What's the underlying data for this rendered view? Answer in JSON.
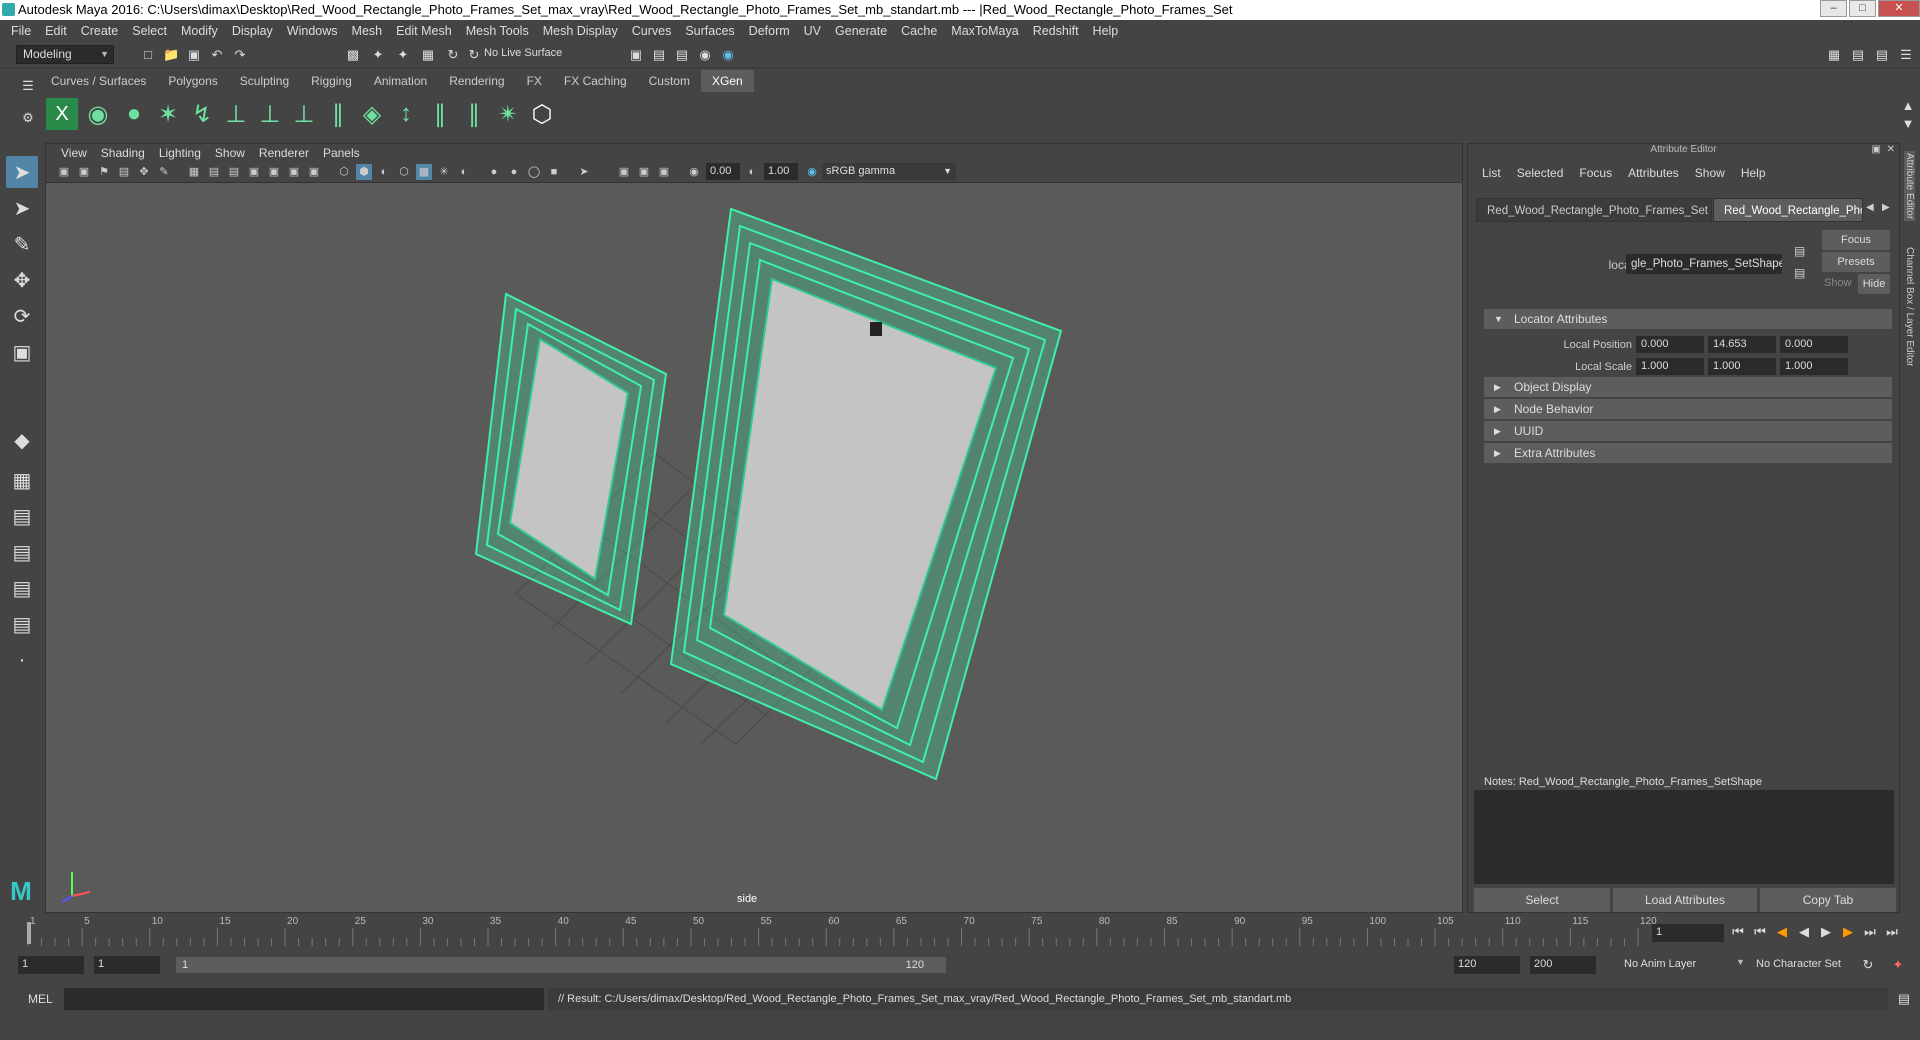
{
  "window": {
    "title": "Autodesk Maya 2016: C:\\Users\\dimax\\Desktop\\Red_Wood_Rectangle_Photo_Frames_Set_max_vray\\Red_Wood_Rectangle_Photo_Frames_Set_mb_standart.mb   ---   |Red_Wood_Rectangle_Photo_Frames_Set"
  },
  "menubar": [
    "File",
    "Edit",
    "Create",
    "Select",
    "Modify",
    "Display",
    "Windows",
    "Mesh",
    "Edit Mesh",
    "Mesh Tools",
    "Mesh Display",
    "Curves",
    "Surfaces",
    "Deform",
    "UV",
    "Generate",
    "Cache",
    "MaxToMaya",
    "Redshift",
    "Help"
  ],
  "toolbar": {
    "mode": "Modeling",
    "live_surface": "No Live Surface"
  },
  "shelf_tabs": [
    "Curves / Surfaces",
    "Polygons",
    "Sculpting",
    "Rigging",
    "Animation",
    "Rendering",
    "FX",
    "FX Caching",
    "Custom",
    "XGen"
  ],
  "shelf_active": "XGen",
  "viewport": {
    "menu": [
      "View",
      "Shading",
      "Lighting",
      "Show",
      "Renderer",
      "Panels"
    ],
    "exposure": "0.00",
    "gamma": "1.00",
    "color_space": "sRGB gamma",
    "camera_label": "side",
    "wire_color": "#3ef0a8"
  },
  "attr_editor": {
    "title": "Attribute Editor",
    "menu": [
      "List",
      "Selected",
      "Focus",
      "Attributes",
      "Show",
      "Help"
    ],
    "tabs": [
      "Red_Wood_Rectangle_Photo_Frames_Set",
      "Red_Wood_Rectangle_Pho"
    ],
    "buttons": {
      "focus": "Focus",
      "presets": "Presets",
      "show": "Show",
      "hide": "Hide"
    },
    "locator_label": "locator:",
    "locator_value": "gle_Photo_Frames_SetShape",
    "sections": [
      "Locator Attributes",
      "Object Display",
      "Node Behavior",
      "UUID",
      "Extra Attributes"
    ],
    "local_position": {
      "label": "Local Position",
      "x": "0.000",
      "y": "14.653",
      "z": "0.000"
    },
    "local_scale": {
      "label": "Local Scale",
      "x": "1.000",
      "y": "1.000",
      "z": "1.000"
    },
    "notes": "Notes:  Red_Wood_Rectangle_Photo_Frames_SetShape",
    "bottom_buttons": [
      "Select",
      "Load Attributes",
      "Copy Tab"
    ]
  },
  "side_tabs": [
    "Attribute Editor",
    "Channel Box / Layer Editor"
  ],
  "timeline": {
    "ticks": [
      "1",
      "5",
      "10",
      "15",
      "20",
      "25",
      "30",
      "35",
      "40",
      "45",
      "50",
      "55",
      "60",
      "65",
      "70",
      "75",
      "80",
      "85",
      "90",
      "95",
      "100",
      "105",
      "110",
      "115",
      "120"
    ],
    "current_frame": "1"
  },
  "range": {
    "start": "1",
    "inner_start": "1",
    "range_start_label": "1",
    "range_end_label": "120",
    "end": "120",
    "anim_end": "200",
    "anim_layer": "No Anim Layer",
    "character_set": "No Character Set"
  },
  "cmd": {
    "lang": "MEL",
    "result": "// Result: C:/Users/dimax/Desktop/Red_Wood_Rectangle_Photo_Frames_Set_max_vray/Red_Wood_Rectangle_Photo_Frames_Set_mb_standart.mb"
  }
}
